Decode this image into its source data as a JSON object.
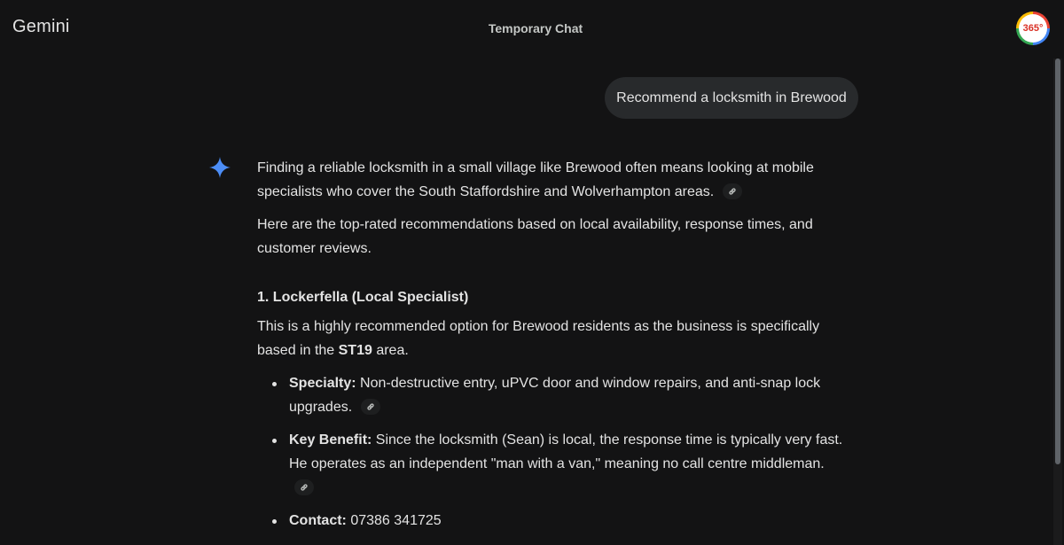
{
  "header": {
    "brand": "Gemini",
    "title": "Temporary Chat",
    "avatar_text": "365°"
  },
  "user_message": "Recommend a locksmith in Brewood",
  "response": {
    "intro_1": "Finding a reliable locksmith in a small village like Brewood often means looking at mobile specialists who cover the South Staffordshire and Wolverhampton areas.",
    "intro_2": "Here are the top-rated recommendations based on local availability, response times, and customer reviews.",
    "section_1_heading": "1. Lockerfella (Local Specialist)",
    "section_1_para_before": "This is a highly recommended option for Brewood residents as the business is specifically based in the ",
    "section_1_para_bold": "ST19",
    "section_1_para_after": " area.",
    "bullets": [
      {
        "label": "Specialty:",
        "text": " Non-destructive entry, uPVC door and window repairs, and anti-snap lock upgrades."
      },
      {
        "label": "Key Benefit:",
        "text": " Since the locksmith (Sean) is local, the response time is typically very fast. He operates as an independent \"man with a van,\" meaning no call centre middleman."
      },
      {
        "label": "Contact:",
        "text": " 07386 341725"
      }
    ]
  },
  "icons": {
    "spark": "gemini-spark-icon",
    "source_link": "link-icon"
  },
  "colors": {
    "background": "#131314",
    "bubble": "#282a2c",
    "spark_blue": "#4c8df6"
  }
}
